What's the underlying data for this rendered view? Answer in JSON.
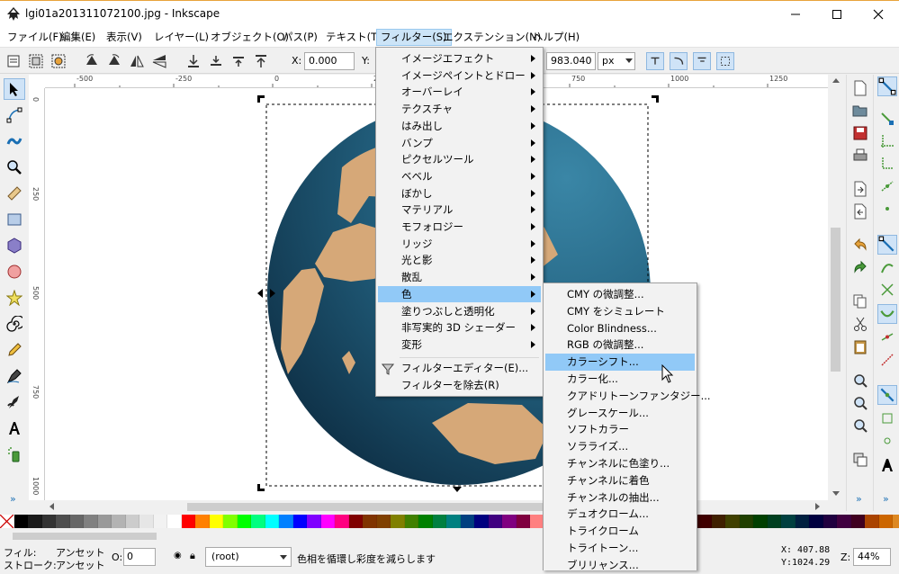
{
  "window": {
    "title": "lgi01a201311072100.jpg - Inkscape"
  },
  "menubar": {
    "items": [
      "ファイル(F)",
      "編集(E)",
      "表示(V)",
      "レイヤー(L)",
      "オブジェクト(O)",
      "パス(P)",
      "テキスト(T)",
      "フィルター(S)",
      "エクステンション(N)",
      "ヘルプ(H)"
    ],
    "active": "フィルター(S)"
  },
  "toolctrl": {
    "x_label": "X:",
    "x_value": "0.000",
    "y_label": "Y:",
    "h_value": "983.040",
    "unit": "px"
  },
  "ruler": {
    "h_ticks": [
      "-500",
      "-250",
      "0",
      "250",
      "500",
      "750",
      "1000",
      "1250"
    ],
    "v_ticks": [
      "0",
      "250",
      "500",
      "750",
      "1000"
    ]
  },
  "filter_menu": {
    "items": [
      {
        "label": "イメージエフェクト",
        "submenu": true
      },
      {
        "label": "イメージペイントとドロー",
        "submenu": true
      },
      {
        "label": "オーバーレイ",
        "submenu": true
      },
      {
        "label": "テクスチャ",
        "submenu": true
      },
      {
        "label": "はみ出し",
        "submenu": true
      },
      {
        "label": "バンプ",
        "submenu": true
      },
      {
        "label": "ピクセルツール",
        "submenu": true
      },
      {
        "label": "ベベル",
        "submenu": true
      },
      {
        "label": "ぼかし",
        "submenu": true
      },
      {
        "label": "マテリアル",
        "submenu": true
      },
      {
        "label": "モフォロジー",
        "submenu": true
      },
      {
        "label": "リッジ",
        "submenu": true
      },
      {
        "label": "光と影",
        "submenu": true
      },
      {
        "label": "散乱",
        "submenu": true
      },
      {
        "label": "色",
        "submenu": true
      },
      {
        "label": "塗りつぶしと透明化",
        "submenu": true
      },
      {
        "label": "非写実的 3D シェーダー",
        "submenu": true
      },
      {
        "label": "変形",
        "submenu": true
      }
    ],
    "highlighted": "色",
    "footer": [
      "フィルターエディター(E)...",
      "フィルターを除去(R)"
    ]
  },
  "color_submenu": {
    "items": [
      "CMY の微調整...",
      "CMY をシミュレート",
      "Color Blindness...",
      "RGB の微調整...",
      "カラーシフト...",
      "カラー化...",
      "クアドリトーンファンタジー...",
      "グレースケール...",
      "ソフトカラー",
      "ソラライズ...",
      "チャンネルに色塗り...",
      "チャンネルに着色",
      "チャンネルの抽出...",
      "デュオクローム...",
      "トライクローム",
      "トライトーン...",
      "ブリリャンス..."
    ],
    "highlighted": "カラーシフト..."
  },
  "statusbar": {
    "fill_label": "フィル:",
    "stroke_label": "ストローク:",
    "fill_value": "アンセット",
    "stroke_value": "アンセット",
    "opacity_label": "O:",
    "opacity_value": "0",
    "layer": "(root)",
    "message": "色相を循環し彩度を減らします",
    "x_coord": "X:  407.88",
    "y_coord": "Y:1024.29",
    "zoom_label": "Z:",
    "zoom": "44%"
  },
  "colors": {
    "menu_highlight": "#91c9f7",
    "ocean_dark": "#123a52",
    "ocean_light": "#2e7898",
    "land": "#d6a878"
  },
  "palette": [
    "#000000",
    "#1a1a1a",
    "#333333",
    "#4d4d4d",
    "#666666",
    "#808080",
    "#999999",
    "#b3b3b3",
    "#cccccc",
    "#e6e6e6",
    "#f2f2f2",
    "#ffffff",
    "#ff0000",
    "#ff8000",
    "#ffff00",
    "#80ff00",
    "#00ff00",
    "#00ff80",
    "#00ffff",
    "#0080ff",
    "#0000ff",
    "#8000ff",
    "#ff00ff",
    "#ff0080",
    "#800000",
    "#803300",
    "#804000",
    "#808000",
    "#408000",
    "#008000",
    "#008040",
    "#008080",
    "#004080",
    "#000080",
    "#400080",
    "#800080",
    "#800040",
    "#ff8080",
    "#ffc080",
    "#ffff80",
    "#c0ff80",
    "#80ff80",
    "#80ffc0",
    "#80ffff",
    "#80c0ff",
    "#8080ff",
    "#c080ff",
    "#ff80ff",
    "#ff80c0",
    "#400000",
    "#402000",
    "#404000",
    "#204000",
    "#004000",
    "#004020",
    "#004040",
    "#002040",
    "#000040",
    "#200040",
    "#400040",
    "#400020",
    "#aa4400",
    "#cc6600",
    "#dd8822"
  ]
}
